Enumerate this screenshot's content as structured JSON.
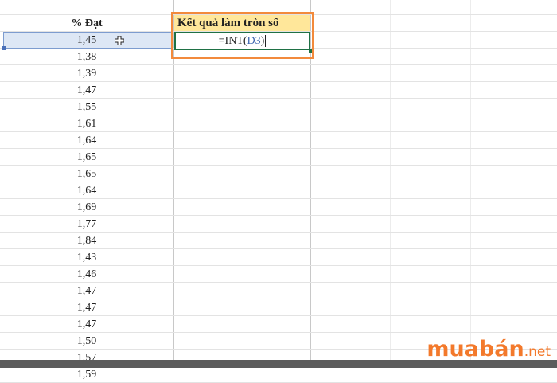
{
  "sheet": {
    "header_d": "% Đạt",
    "header_e": "Kết quả làm tròn số",
    "formula": {
      "prefix": "=INT(",
      "ref": "D3",
      "suffix": ")"
    },
    "values": [
      "1,45",
      "1,38",
      "1,39",
      "1,47",
      "1,55",
      "1,61",
      "1,64",
      "1,65",
      "1,65",
      "1,64",
      "1,69",
      "1,77",
      "1,84",
      "1,43",
      "1,46",
      "1,47",
      "1,47",
      "1,47",
      "1,50",
      "1,57",
      "1,59"
    ]
  },
  "logo": {
    "main": "muabán",
    "suffix": ".net"
  },
  "colors": {
    "header_fill": "#ffe79a",
    "highlight_border": "#f28a3c",
    "active_cell": "#dde7f5",
    "edit_border": "#1f7145",
    "ref_text": "#3d65b0",
    "logo": "#f3792b"
  }
}
